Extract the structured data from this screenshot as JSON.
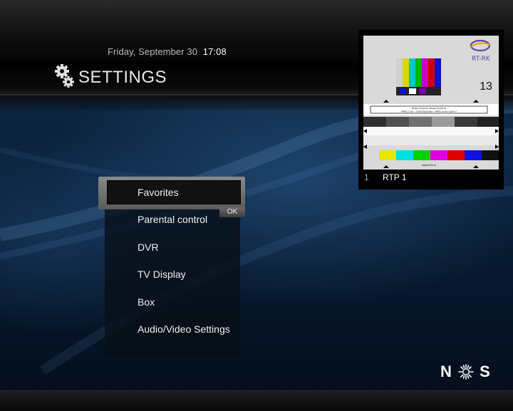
{
  "header": {
    "date": "Friday, September 30",
    "time": "17:08",
    "title": "SETTINGS",
    "icon": "gears-icon"
  },
  "menu": {
    "items": [
      {
        "label": "Favorites",
        "selected": true
      },
      {
        "label": "Parental control"
      },
      {
        "label": "DVR"
      },
      {
        "label": "TV Display"
      },
      {
        "label": "Box"
      },
      {
        "label": "Audio/Video Settings"
      }
    ],
    "ok_label": "OK"
  },
  "preview": {
    "channel_number": "1",
    "channel_name": "RTP 1",
    "test_card": {
      "logo_text": "RT-RK",
      "number": "13",
      "info_line1": "RT-RK Computer Based Systems",
      "info_line2": "MPEG-2 SD - 720x576@25fps - MPEG Audio Layer 2",
      "url": "www.rtrk.rs"
    }
  },
  "brand": {
    "letters": [
      "N",
      "S"
    ],
    "logo_icon": "nos-sun-icon"
  },
  "colors": {
    "background": "#0a213b",
    "highlight": "#7a7a7a",
    "text": "#ffffff"
  }
}
